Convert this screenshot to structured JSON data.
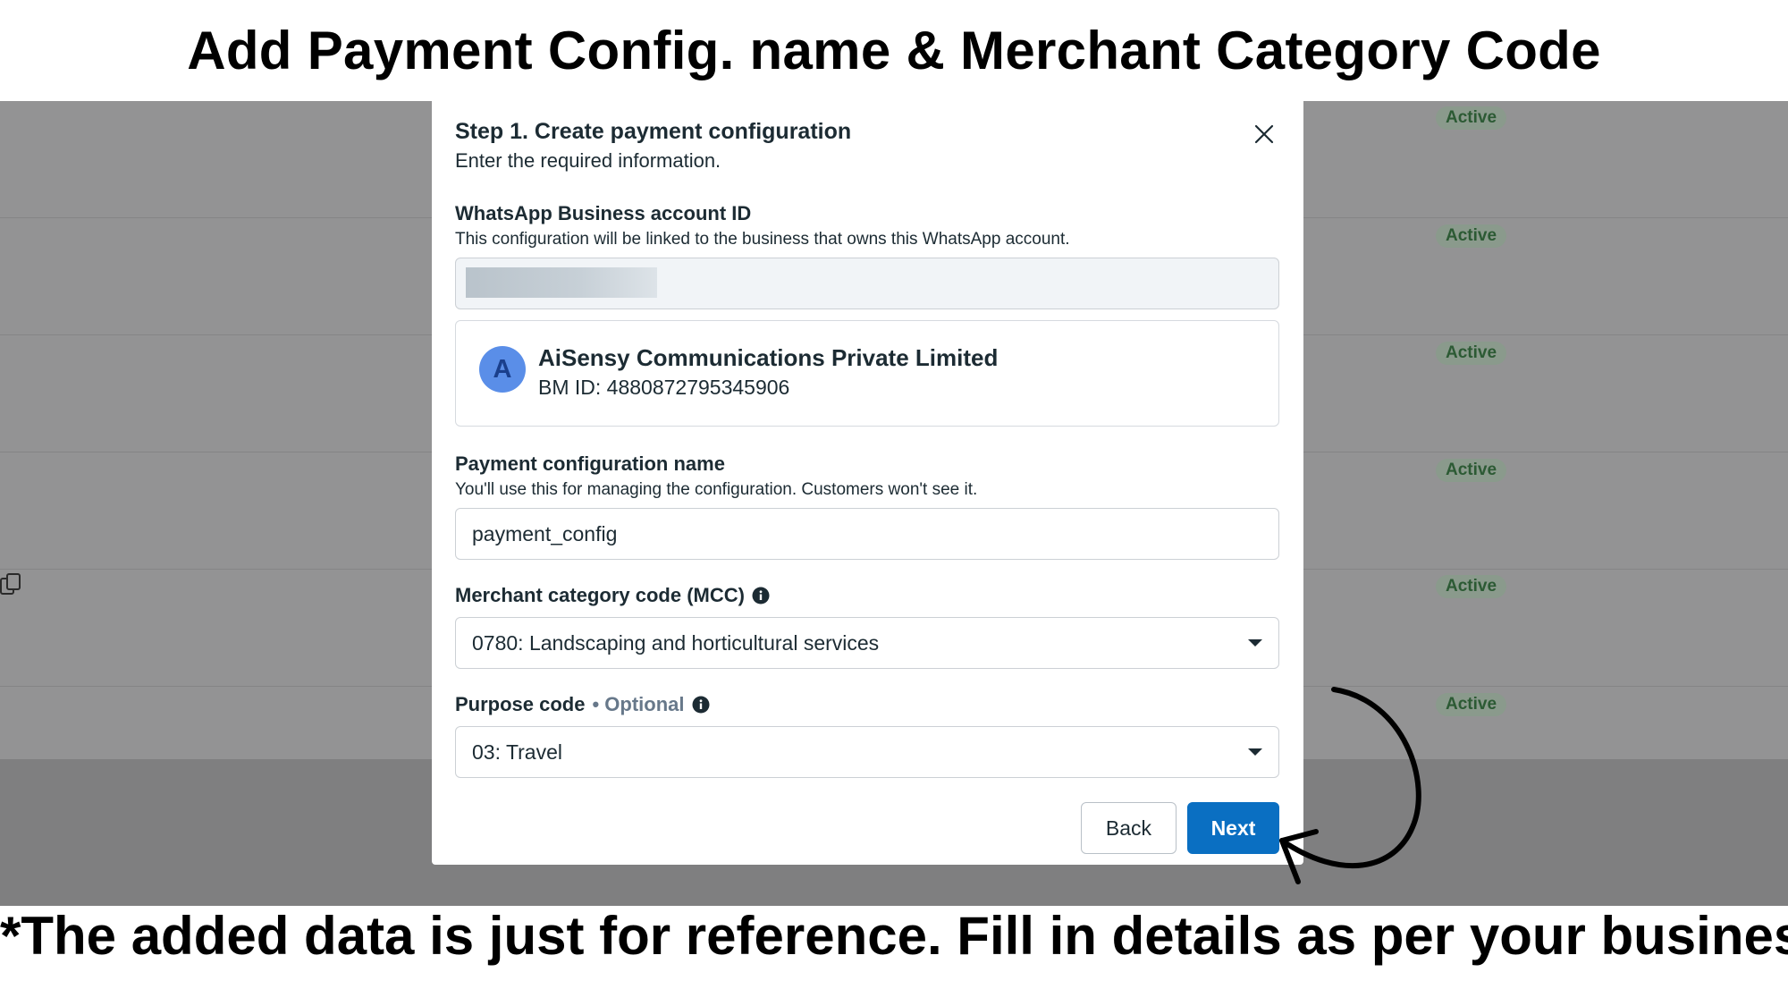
{
  "headline": "Add Payment Config. name & Merchant Category Code",
  "footnote": "*The added data is just for reference. Fill in details as per your business",
  "background": {
    "status_pills": [
      "Active",
      "Active",
      "Active",
      "Active",
      "Active",
      "Active"
    ]
  },
  "modal": {
    "title": "Step 1. Create payment configuration",
    "subtitle": "Enter the required information.",
    "waba": {
      "label": "WhatsApp Business account ID",
      "help": "This configuration will be linked to the business that owns this WhatsApp account."
    },
    "business": {
      "avatar_letter": "A",
      "name": "AiSensy Communications Private Limited",
      "bm_id": "BM ID: 4880872795345906"
    },
    "config_name": {
      "label": "Payment configuration name",
      "help": "You'll use this for managing the configuration. Customers won't see it.",
      "value": "payment_config"
    },
    "mcc": {
      "label": "Merchant category code (MCC)",
      "value": "0780: Landscaping and horticultural services"
    },
    "purpose": {
      "label": "Purpose code",
      "optional": "• Optional",
      "value": "03: Travel"
    },
    "buttons": {
      "back": "Back",
      "next": "Next"
    }
  },
  "colors": {
    "primary_button": "#0a6fc2",
    "overlay": "#939394",
    "avatar": "#5a8ee8"
  },
  "icons": [
    "close-icon",
    "info-icon",
    "chevron-down-icon",
    "copy-icon",
    "curved-arrow-icon"
  ]
}
